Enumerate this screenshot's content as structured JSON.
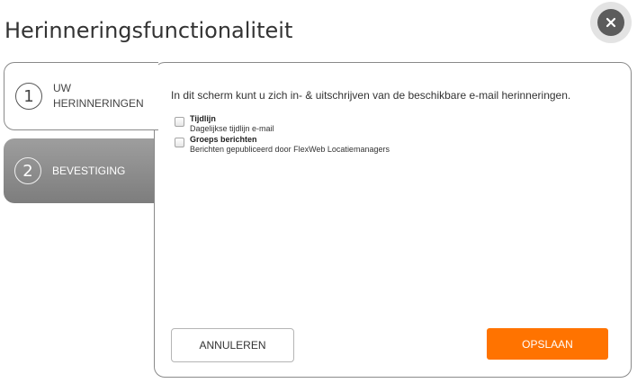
{
  "dialog": {
    "title": "Herinneringsfunctionaliteit",
    "close_icon": "close-icon"
  },
  "steps": [
    {
      "number": "1",
      "label_line1": "UW",
      "label_line2": "HERINNERINGEN",
      "state": "active"
    },
    {
      "number": "2",
      "label_line1": "BEVESTIGING",
      "label_line2": "",
      "state": "inactive"
    }
  ],
  "content": {
    "intro": "In dit scherm kunt u zich in- & uitschrijven van de beschikbare e-mail herinneringen.",
    "options": [
      {
        "title": "Tijdlijn",
        "description": "Dagelijkse tijdlijn e-mail",
        "checked": false
      },
      {
        "title": "Groeps berichten",
        "description": "Berichten gepubliceerd door FlexWeb Locatiemanagers",
        "checked": false
      }
    ]
  },
  "buttons": {
    "cancel_label": "ANNULEREN",
    "save_label": "OPSLAAN"
  },
  "colors": {
    "accent": "#ff7300",
    "inactive_tab": "#8a8a8a"
  }
}
